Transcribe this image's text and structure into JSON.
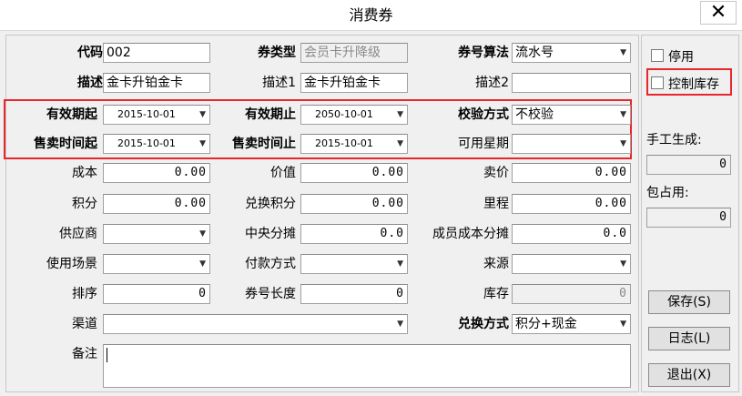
{
  "window": {
    "title": "消费券",
    "close_glyph": "✕"
  },
  "rows": {
    "code": {
      "label": "代码",
      "value": "002"
    },
    "type": {
      "label": "券类型",
      "value": "会员卡升降级"
    },
    "algo": {
      "label": "券号算法",
      "value": "流水号"
    },
    "desc": {
      "label": "描述",
      "value": "金卡升铂金卡"
    },
    "desc1": {
      "label": "描述1",
      "value": "金卡升铂金卡"
    },
    "desc2": {
      "label": "描述2",
      "value": ""
    },
    "valid_from": {
      "label": "有效期起",
      "value": "2015-10-01"
    },
    "valid_to": {
      "label": "有效期止",
      "value": "2050-10-01"
    },
    "check_mode": {
      "label": "校验方式",
      "value": "不校验"
    },
    "sale_from": {
      "label": "售卖时间起",
      "value": "2015-10-01"
    },
    "sale_to": {
      "label": "售卖时间止",
      "value": "2015-10-01"
    },
    "weekday": {
      "label": "可用星期",
      "value": ""
    },
    "cost": {
      "label": "成本",
      "value": "0.00"
    },
    "worth": {
      "label": "价值",
      "value": "0.00"
    },
    "price": {
      "label": "卖价",
      "value": "0.00"
    },
    "points": {
      "label": "积分",
      "value": "0.00"
    },
    "redeem_points": {
      "label": "兑换积分",
      "value": "0.00"
    },
    "mileage": {
      "label": "里程",
      "value": "0.00"
    },
    "supplier": {
      "label": "供应商",
      "value": ""
    },
    "central_share": {
      "label": "中央分摊",
      "value": "0.0"
    },
    "member_share": {
      "label": "成员成本分摊",
      "value": "0.0"
    },
    "scene": {
      "label": "使用场景",
      "value": ""
    },
    "payment": {
      "label": "付款方式",
      "value": ""
    },
    "source": {
      "label": "来源",
      "value": ""
    },
    "sort": {
      "label": "排序",
      "value": "0"
    },
    "code_len": {
      "label": "券号长度",
      "value": "0"
    },
    "stock": {
      "label": "库存",
      "value": "0"
    },
    "channel": {
      "label": "渠道",
      "value": ""
    },
    "redeem_mode": {
      "label": "兑换方式",
      "value": "积分+现金"
    },
    "remark": {
      "label": "备注",
      "value": ""
    }
  },
  "side": {
    "disabled_label": "停用",
    "control_stock_label": "控制库存",
    "manual_gen_label": "手工生成:",
    "manual_gen_value": "0",
    "included_label": "包占用:",
    "included_value": "0",
    "save_button": "保存(S)",
    "log_button": "日志(L)",
    "exit_button": "退出(X)"
  },
  "accent_red": "#e8262c"
}
